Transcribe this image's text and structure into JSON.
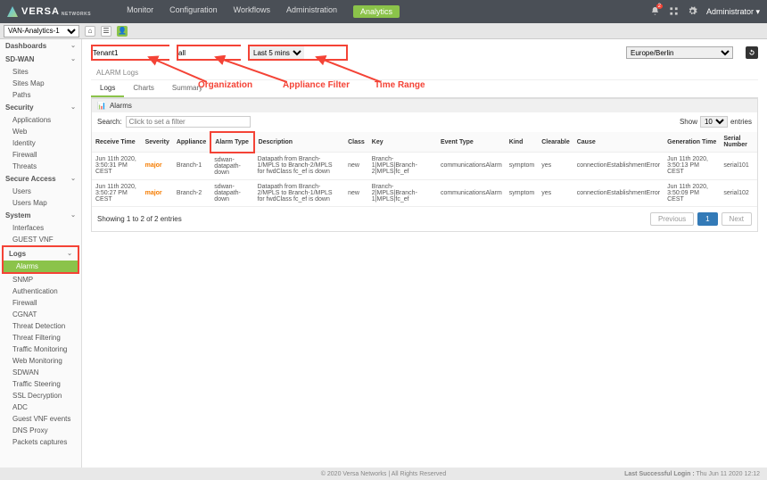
{
  "header": {
    "brand": "VERSA",
    "brand_sub": "NETWORKS",
    "nav": [
      "Monitor",
      "Configuration",
      "Workflows",
      "Administration",
      "Analytics"
    ],
    "active_nav": 4,
    "notif_count": "2",
    "user_label": "Administrator ▾"
  },
  "subheader": {
    "tenant": "VAN-Analytics-1"
  },
  "sidebar": {
    "dashboards_label": "Dashboards",
    "sdwan": {
      "label": "SD-WAN",
      "items": [
        "Sites",
        "Sites Map",
        "Paths"
      ]
    },
    "security": {
      "label": "Security",
      "items": [
        "Applications",
        "Web",
        "Identity",
        "Firewall",
        "Threats"
      ]
    },
    "secure_access": {
      "label": "Secure Access",
      "items": [
        "Users",
        "Users Map"
      ]
    },
    "system": {
      "label": "System",
      "items": [
        "Interfaces",
        "GUEST VNF"
      ]
    },
    "logs": {
      "label": "Logs",
      "items": [
        "Alarms",
        "SNMP",
        "Authentication",
        "Firewall",
        "CGNAT",
        "Threat Detection",
        "Threat Filtering",
        "Traffic Monitoring",
        "Web Monitoring",
        "SDWAN",
        "Traffic Steering",
        "SSL Decryption",
        "ADC",
        "Guest VNF events",
        "DNS Proxy",
        "Packets captures"
      ],
      "highlighted": 0
    }
  },
  "filters": {
    "org_value": "Tenant1",
    "appliance_value": "all",
    "time_value": "Last 5 mins",
    "tz_value": "Europe/Berlin"
  },
  "annotations": {
    "org": "Organization",
    "appliance": "Appliance Filter",
    "time": "Time Range"
  },
  "panel": {
    "breadcrumb": "ALARM Logs",
    "tabs": [
      "Logs",
      "Charts",
      "Summary"
    ],
    "active_tab": 0,
    "card_title": "Alarms",
    "search_label": "Search:",
    "search_placeholder": "Click to set a filter",
    "show_label": "Show",
    "show_value": "10",
    "entries_label": "entries",
    "columns": [
      "Receive Time",
      "Severity",
      "Appliance",
      "Alarm Type",
      "Description",
      "Class",
      "Key",
      "Event Type",
      "Kind",
      "Clearable",
      "Cause",
      "Generation Time",
      "Serial Number"
    ],
    "highlight_col_index": 3,
    "rows": [
      {
        "receive": "Jun 11th 2020, 3:50:31 PM CEST",
        "severity": "major",
        "appliance": "Branch-1",
        "alarm_type": "sdwan-datapath-down",
        "description": "Datapath from Branch-1/MPLS to Branch-2/MPLS for fwdClass fc_ef is down",
        "class": "new",
        "key": "Branch-1|MPLS|Branch-2|MPLS|fc_ef",
        "event_type": "communicationsAlarm",
        "kind": "symptom",
        "clearable": "yes",
        "cause": "connectionEstablishmentError",
        "gen": "Jun 11th 2020, 3:50:13 PM CEST",
        "serial": "serial101"
      },
      {
        "receive": "Jun 11th 2020, 3:50:27 PM CEST",
        "severity": "major",
        "appliance": "Branch-2",
        "alarm_type": "sdwan-datapath-down",
        "description": "Datapath from Branch-2/MPLS to Branch-1/MPLS for fwdClass fc_ef is down",
        "class": "new",
        "key": "Branch-2|MPLS|Branch-1|MPLS|fc_ef",
        "event_type": "communicationsAlarm",
        "kind": "symptom",
        "clearable": "yes",
        "cause": "connectionEstablishmentError",
        "gen": "Jun 11th 2020, 3:50:09 PM CEST",
        "serial": "serial102"
      }
    ],
    "pager_info": "Showing 1 to 2 of 2 entries",
    "prev_label": "Previous",
    "next_label": "Next",
    "page_num": "1"
  },
  "footer": {
    "center": "© 2020 Versa Networks | All Rights Reserved",
    "right_label": "Last Successful Login :",
    "right_value": "Thu Jun 11 2020 12:12"
  }
}
